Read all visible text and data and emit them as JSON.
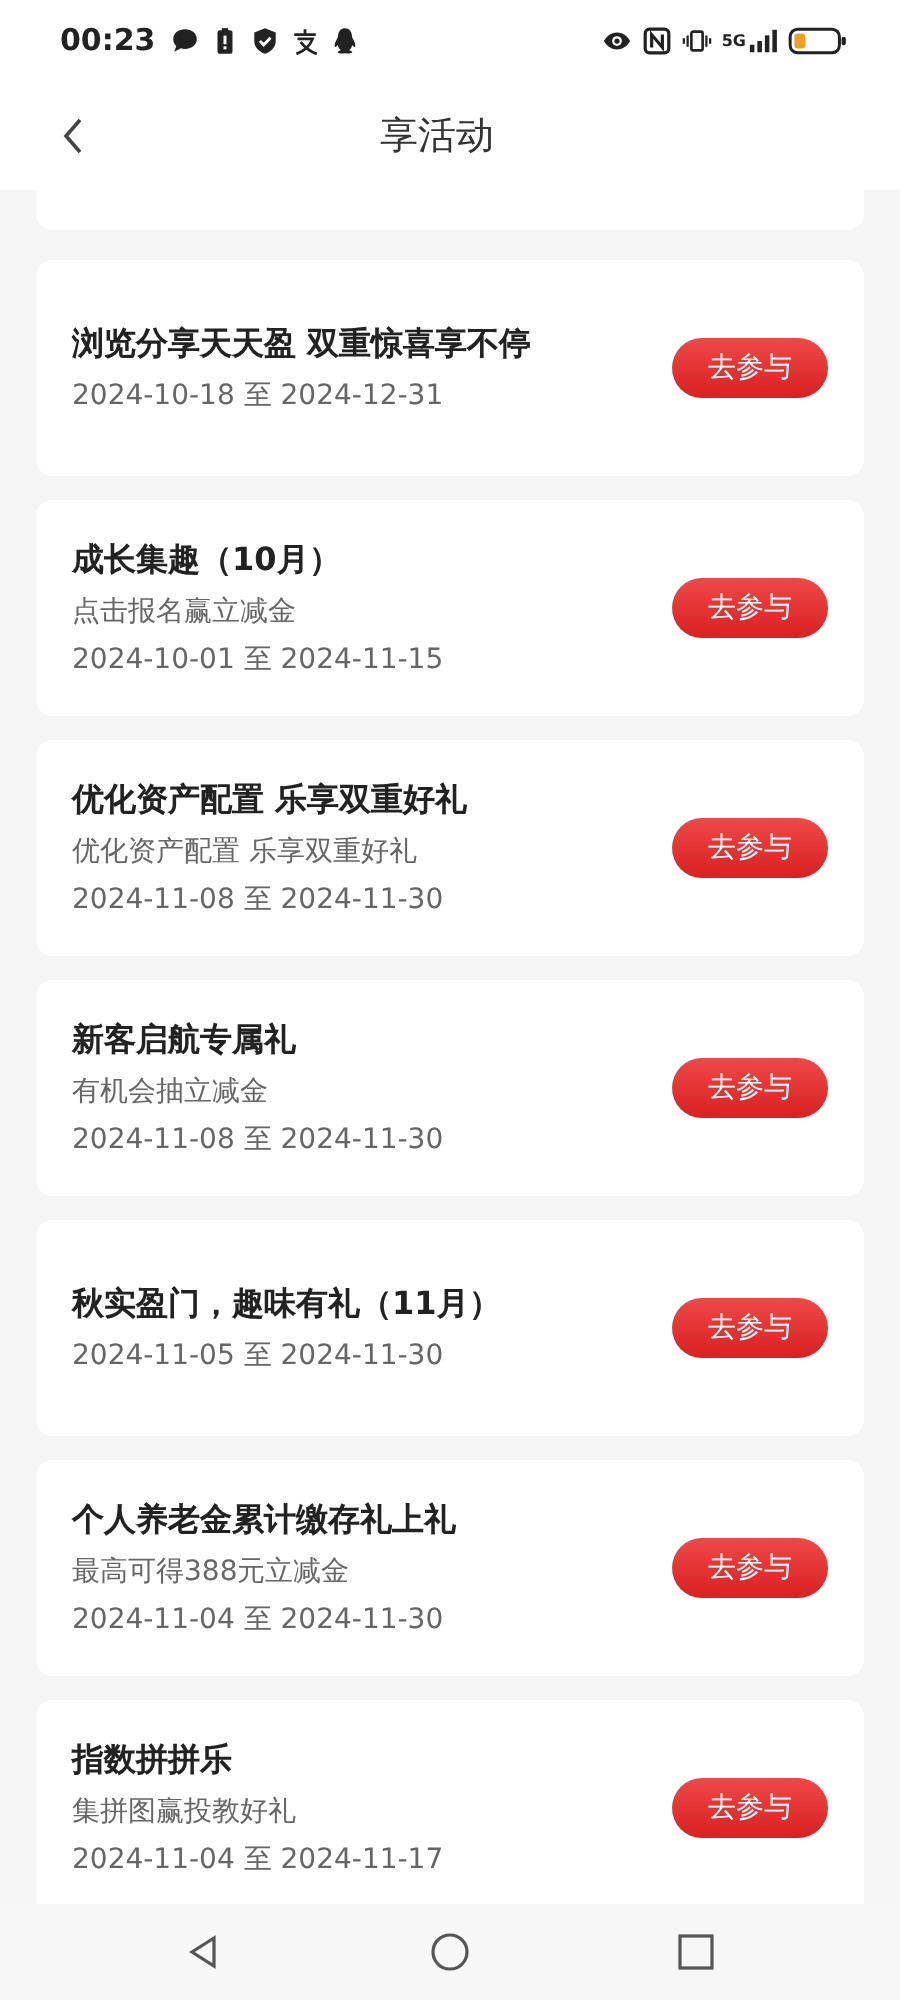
{
  "status_bar": {
    "time": "00:23",
    "network": "5G"
  },
  "header": {
    "title": "享活动"
  },
  "activities": [
    {
      "title": "浏览分享天天盈 双重惊喜享不停",
      "dates": "2024-10-18 至 2024-12-31",
      "button": "去参与"
    },
    {
      "title": "成长集趣（10月）",
      "subtitle": "点击报名赢立减金",
      "dates": "2024-10-01 至 2024-11-15",
      "button": "去参与"
    },
    {
      "title": "优化资产配置 乐享双重好礼",
      "subtitle": "优化资产配置 乐享双重好礼",
      "dates": "2024-11-08 至 2024-11-30",
      "button": "去参与"
    },
    {
      "title": "新客启航专属礼",
      "subtitle": "有机会抽立减金",
      "dates": "2024-11-08 至 2024-11-30",
      "button": "去参与"
    },
    {
      "title": "秋实盈门，趣味有礼（11月）",
      "dates": "2024-11-05 至 2024-11-30",
      "button": "去参与"
    },
    {
      "title": "个人养老金累计缴存礼上礼",
      "subtitle": "最高可得388元立减金",
      "dates": "2024-11-04 至 2024-11-30",
      "button": "去参与"
    },
    {
      "title": "指数拼拼乐",
      "subtitle": "集拼图赢投教好礼",
      "dates": "2024-11-04 至 2024-11-17",
      "button": "去参与"
    }
  ]
}
